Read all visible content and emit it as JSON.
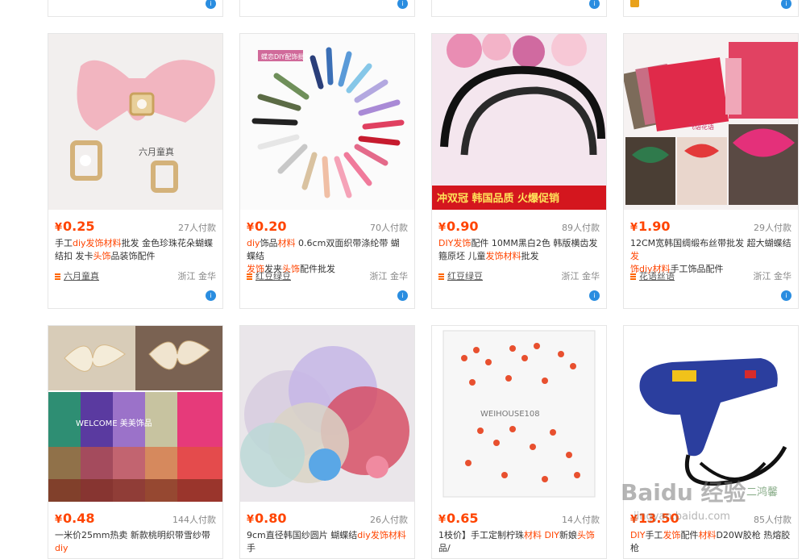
{
  "top_row": [
    {
      "icon": "wangwang"
    },
    {
      "icon": "wangwang"
    },
    {
      "icon": "wangwang"
    },
    {
      "icon": "wangwang"
    }
  ],
  "products": [
    {
      "currency": "¥",
      "price": "0.25",
      "sold": "27人付款",
      "title_pre": "手工",
      "title_hl": "diy发饰材料",
      "title_post": "批发 金色珍珠花朵蝴蝶结扣 发卡",
      "title_hl2": "头饰",
      "title_post2": "品装饰配件",
      "shop": "六月童真",
      "location": "浙江 金华",
      "image_label": "pink bow with pearl buckle",
      "image_caption": "六月童真"
    },
    {
      "currency": "¥",
      "price": "0.20",
      "sold": "70人付款",
      "title_pre": "",
      "title_hl": "diy",
      "title_post": "饰品",
      "title_hl2": "材料",
      "title_post2": " 0.6cm双面织带涤纶带 蝴蝶结",
      "title_line2_hl": "发饰",
      "title_line2": "发夹",
      "title_line2_hl2": "头饰",
      "title_line2_post": "配件批发",
      "shop": "红豆绿豆",
      "location": "浙江 金华",
      "image_label": "colored ribbon bows fan",
      "image_caption": "蝶恋DIY配饰批发"
    },
    {
      "currency": "¥",
      "price": "0.90",
      "sold": "89人付款",
      "title_pre": "",
      "title_hl": "DIY发饰",
      "title_post": "配件 10MM黑白2色 韩版横齿发箍原坯 儿童",
      "title_hl2": "发饰材料",
      "title_post2": "批发",
      "shop": "红豆绿豆",
      "location": "浙江 金华",
      "image_label": "black headbands",
      "image_caption": "冲双冠 韩国品质 火爆促销"
    },
    {
      "currency": "¥",
      "price": "1.90",
      "sold": "29人付款",
      "title_pre": "12CM宽韩国绸缎布丝带批发 超大蝴蝶结",
      "title_hl": "发",
      "title_post": "",
      "title_hl2": "饰diy材料",
      "title_post2": "手工饰品配件",
      "shop": "花语丝语",
      "location": "浙江 金华",
      "image_label": "satin fabric and bows",
      "image_caption": "飞语花语"
    },
    {
      "currency": "¥",
      "price": "0.48",
      "sold": "144人付款",
      "title_pre": "一米价25mm热卖 新款桃明织带雪纱带",
      "title_hl": "diy",
      "title_post": "",
      "title_hl2": "",
      "title_post2": "",
      "shop": "",
      "location": "",
      "image_label": "organza ribbon rolls",
      "image_caption": "WELCOME 美美饰品"
    },
    {
      "currency": "¥",
      "price": "0.80",
      "sold": "26人付款",
      "title_pre": "9cm直径韩国纱圆片 蝴蝶结",
      "title_hl": "diy发饰材料",
      "title_post": " 手",
      "title_hl2": "",
      "title_post2": "",
      "shop": "",
      "location": "",
      "image_label": "round tulle circles",
      "image_caption": ""
    },
    {
      "currency": "¥",
      "price": "0.65",
      "sold": "14人付款",
      "title_pre": "1枝价】手工定制柠珠",
      "title_hl": "材料",
      "title_post": " ",
      "title_hl2": "DIY",
      "title_post2": "新娘",
      "title_hl3": "头饰",
      "title_post3": "品/",
      "shop": "",
      "location": "",
      "image_label": "red crystal bead branches",
      "image_caption": "WEIHOUSE108"
    },
    {
      "currency": "¥",
      "price": "13.50",
      "sold": "85人付款",
      "title_pre": "",
      "title_hl": "DIY",
      "title_post": "手工",
      "title_hl2": "发饰",
      "title_post2": "配件",
      "title_hl3": "材料",
      "title_post3": "D20W胶枪 热熔胶枪",
      "shop": "",
      "location": "",
      "image_label": "blue hot glue gun",
      "image_caption": ""
    }
  ],
  "watermark": {
    "text": "Baidu 经验",
    "sub": "jingyan.baidu.com",
    "extra": "二鸿馨"
  },
  "colors": {
    "accent": "#ff4400",
    "border": "#e6e6e6",
    "wangwang": "#2a8de0"
  }
}
